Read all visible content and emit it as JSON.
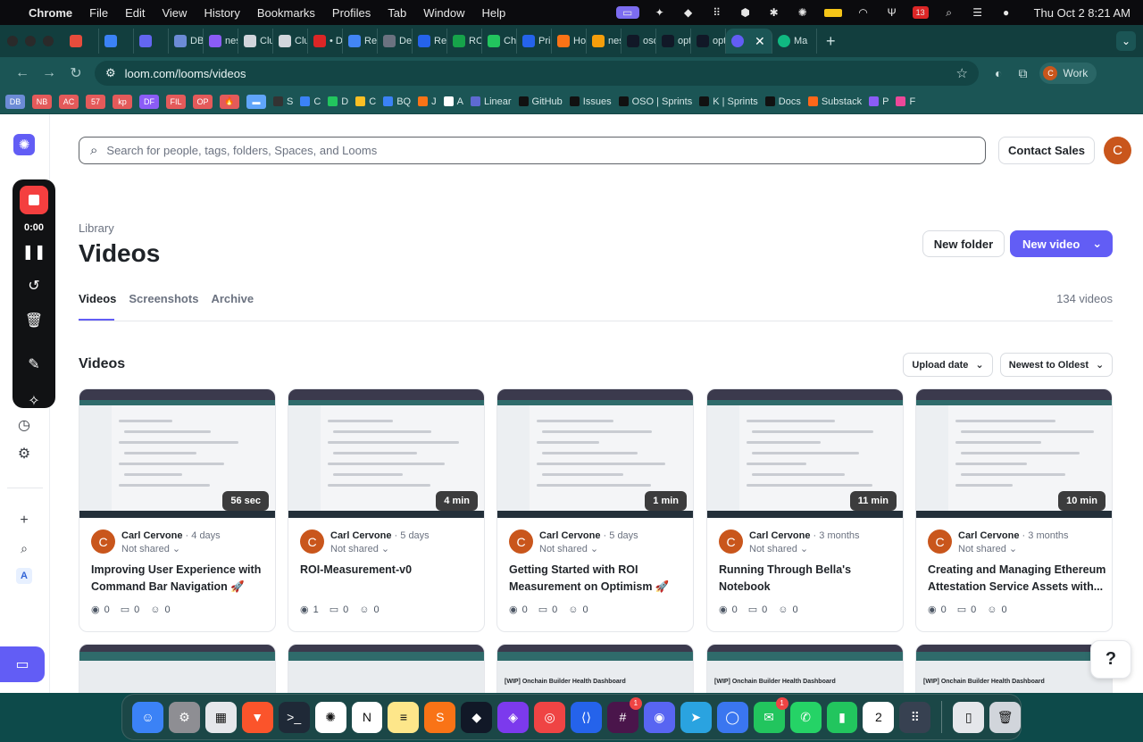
{
  "menubar": {
    "apple": "",
    "app_name": "Chrome",
    "items": [
      "File",
      "Edit",
      "View",
      "History",
      "Bookmarks",
      "Profiles",
      "Tab",
      "Window",
      "Help"
    ],
    "clock": "Thu Oct 2  8:21 AM"
  },
  "tabs": [
    {
      "label": "",
      "color": "#e74c3c"
    },
    {
      "label": "",
      "color": "#3b82f6"
    },
    {
      "label": "",
      "color": "#6366f1"
    },
    {
      "label": "DB",
      "color": "#6c8bd6"
    },
    {
      "label": "nes",
      "color": "#8b5cf6"
    },
    {
      "label": "Clu",
      "color": "#d1d5db"
    },
    {
      "label": "Clu",
      "color": "#d1d5db"
    },
    {
      "label": "• D",
      "color": "#dc2626"
    },
    {
      "label": "Ref",
      "color": "#4285f4"
    },
    {
      "label": "Def",
      "color": "#6b7280"
    },
    {
      "label": "Rep",
      "color": "#2563eb"
    },
    {
      "label": "RO",
      "color": "#16a34a"
    },
    {
      "label": "Ch",
      "color": "#22c55e"
    },
    {
      "label": "Pri",
      "color": "#2563eb"
    },
    {
      "label": "Ho",
      "color": "#f97316"
    },
    {
      "label": "nes",
      "color": "#f59e0b"
    },
    {
      "label": "oso",
      "color": "#111827"
    },
    {
      "label": "opt",
      "color": "#111827"
    },
    {
      "label": "opt",
      "color": "#111827"
    }
  ],
  "active_tab": {
    "label": "",
    "color": "#625df5"
  },
  "extra_tab": {
    "label": "Ma",
    "color": "#10b981"
  },
  "address": {
    "url": "loom.com/looms/videos",
    "profile": "Work",
    "profile_initial": "C"
  },
  "bookmark_chips": [
    {
      "label": "DB",
      "color": "#6c8bd6"
    },
    {
      "label": "NB",
      "color": "#e45a5a"
    },
    {
      "label": "AC",
      "color": "#e45a5a"
    },
    {
      "label": "57",
      "color": "#e45a5a"
    },
    {
      "label": "kp",
      "color": "#e45a5a"
    },
    {
      "label": "DF",
      "color": "#8b5cf6"
    },
    {
      "label": "FIL",
      "color": "#e45a5a"
    },
    {
      "label": "OP",
      "color": "#e45a5a"
    },
    {
      "label": "🔥",
      "color": "#e45a5a"
    },
    {
      "label": "▬",
      "color": "#60a5fa"
    }
  ],
  "bookmarks": [
    {
      "label": "S",
      "color": "#333"
    },
    {
      "label": "C",
      "color": "#3b82f6"
    },
    {
      "label": "D",
      "color": "#22c55e"
    },
    {
      "label": "C",
      "color": "#fbbf24"
    },
    {
      "label": "BQ",
      "color": "#3b82f6"
    },
    {
      "label": "J",
      "color": "#f97316"
    },
    {
      "label": "A",
      "color": "#fff"
    },
    {
      "label": "Linear",
      "color": "#5e6ad2"
    },
    {
      "label": "GitHub",
      "color": "#111"
    },
    {
      "label": "Issues",
      "color": "#111"
    },
    {
      "label": "OSO | Sprints",
      "color": "#111"
    },
    {
      "label": "K | Sprints",
      "color": "#111"
    },
    {
      "label": "Docs",
      "color": "#111"
    },
    {
      "label": "Substack",
      "color": "#ff6719"
    },
    {
      "label": "P",
      "color": "#8b5cf6"
    },
    {
      "label": "F",
      "color": "#ec4899"
    }
  ],
  "search": {
    "placeholder": "Search for people, tags, folders, Spaces, and Looms"
  },
  "header": {
    "contact_sales": "Contact Sales",
    "avatar_initial": "C"
  },
  "recorder": {
    "time": "0:00"
  },
  "library": {
    "label": "Library",
    "title": "Videos",
    "new_folder": "New folder",
    "new_video": "New video",
    "tabs": [
      "Videos",
      "Screenshots",
      "Archive"
    ],
    "count": "134 videos",
    "section_title": "Videos",
    "sort_field": "Upload date",
    "sort_order": "Newest to Oldest"
  },
  "videos": [
    {
      "author": "Carl Cervone",
      "age": "4 days",
      "shared": "Not shared",
      "title": "Improving User Experience with Command Bar Navigation 🚀",
      "duration": "56 sec",
      "views": "0",
      "comments": "0",
      "reactions": "0",
      "initial": "C"
    },
    {
      "author": "Carl Cervone",
      "age": "5 days",
      "shared": "Not shared",
      "title": "ROI-Measurement-v0",
      "duration": "4 min",
      "views": "1",
      "comments": "0",
      "reactions": "0",
      "initial": "C"
    },
    {
      "author": "Carl Cervone",
      "age": "5 days",
      "shared": "Not shared",
      "title": "Getting Started with ROI Measurement on Optimism 🚀",
      "duration": "1 min",
      "views": "0",
      "comments": "0",
      "reactions": "0",
      "initial": "C"
    },
    {
      "author": "Carl Cervone",
      "age": "3 months",
      "shared": "Not shared",
      "title": "Running Through Bella's Notebook",
      "duration": "11 min",
      "views": "0",
      "comments": "0",
      "reactions": "0",
      "initial": "C"
    },
    {
      "author": "Carl Cervone",
      "age": "3 months",
      "shared": "Not shared",
      "title": "Creating and Managing Ethereum Attestation Service Assets with...",
      "duration": "10 min",
      "views": "0",
      "comments": "0",
      "reactions": "0",
      "initial": "C"
    }
  ],
  "second_row": [
    {
      "caption": ""
    },
    {
      "caption": ""
    },
    {
      "caption": "[WIP] Onchain Builder Health Dashboard"
    },
    {
      "caption": "[WIP] Onchain Builder Health Dashboard"
    },
    {
      "caption": "[WIP] Onchain Builder Health Dashboard"
    }
  ],
  "help": "?",
  "dock": [
    {
      "name": "finder",
      "color": "#3b82f6",
      "glyph": "☺"
    },
    {
      "name": "settings",
      "color": "#8e8e93",
      "glyph": "⚙"
    },
    {
      "name": "launchpad",
      "color": "#e5e7eb",
      "glyph": "▦"
    },
    {
      "name": "brave",
      "color": "#fb542b",
      "glyph": "▼"
    },
    {
      "name": "terminal",
      "color": "#1f2937",
      "glyph": ">_"
    },
    {
      "name": "chatgpt",
      "color": "#ffffff",
      "glyph": "✺"
    },
    {
      "name": "notion",
      "color": "#ffffff",
      "glyph": "N"
    },
    {
      "name": "notes",
      "color": "#fde68a",
      "glyph": "≡"
    },
    {
      "name": "sublime",
      "color": "#f97316",
      "glyph": "S"
    },
    {
      "name": "cursor",
      "color": "#111827",
      "glyph": "◆"
    },
    {
      "name": "obsidian",
      "color": "#7c3aed",
      "glyph": "◈"
    },
    {
      "name": "chrome",
      "color": "#ef4444",
      "glyph": "◎"
    },
    {
      "name": "vscode",
      "color": "#2563eb",
      "glyph": "⟨⟩"
    },
    {
      "name": "slack",
      "color": "#4a154b",
      "glyph": "#",
      "badge": "1"
    },
    {
      "name": "discord",
      "color": "#5865f2",
      "glyph": "◉"
    },
    {
      "name": "telegram",
      "color": "#2aa3e0",
      "glyph": "➤"
    },
    {
      "name": "signal",
      "color": "#3a76f0",
      "glyph": "◯"
    },
    {
      "name": "messages",
      "color": "#22c55e",
      "glyph": "✉",
      "badge": "1"
    },
    {
      "name": "whatsapp",
      "color": "#25d366",
      "glyph": "✆"
    },
    {
      "name": "numbers",
      "color": "#22c55e",
      "glyph": "▮"
    },
    {
      "name": "calendar",
      "color": "#ffffff",
      "glyph": "2"
    },
    {
      "name": "grid-app",
      "color": "#374151",
      "glyph": "⠿"
    }
  ],
  "dock_extra": [
    {
      "name": "downloads",
      "color": "#e5e7eb",
      "glyph": "▯"
    },
    {
      "name": "trash",
      "color": "#d1d5db",
      "glyph": "🗑"
    }
  ]
}
